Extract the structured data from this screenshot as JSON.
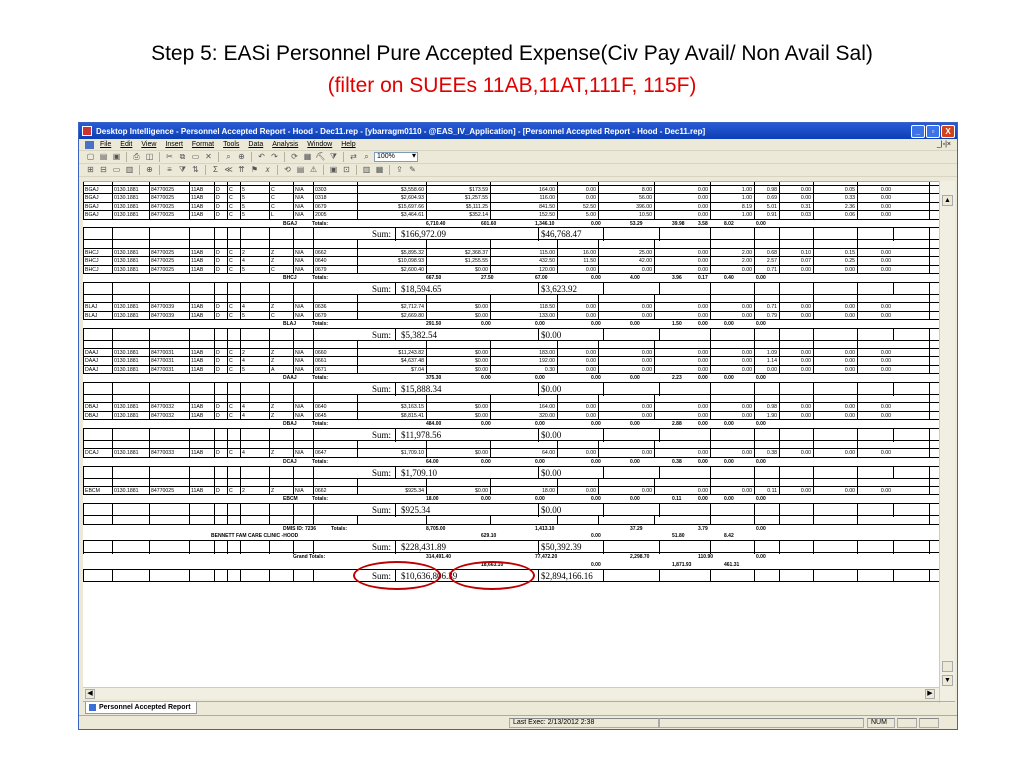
{
  "slide": {
    "title": "Step 5:  EASi Personnel Pure Accepted Expense(Civ Pay Avail/ Non Avail Sal)",
    "subtitle": "(filter on SUEEs 11AB,11AT,111F, 115F)"
  },
  "window": {
    "title": "Desktop Intelligence - Personnel Accepted Report - Hood - Dec11.rep - [ybarragm0110 - @EAS_IV_Application] - [Personnel Accepted Report - Hood - Dec11.rep]",
    "buttons": [
      "_",
      "▫",
      "X"
    ],
    "mdi_buttons": "_|▫|×"
  },
  "menu": [
    "File",
    "Edit",
    "View",
    "Insert",
    "Format",
    "Tools",
    "Data",
    "Analysis",
    "Window",
    "Help"
  ],
  "toolbar": {
    "zoom": "100%"
  },
  "report": {
    "groups": [
      {
        "rows": [
          [
            "BGAJ",
            "0130.1881",
            "84770025",
            "11AB",
            "D",
            "C",
            "5",
            "C",
            "N/A",
            "0303",
            "$3,558.60",
            "$173.59",
            "164.00",
            "0.00",
            "8.00",
            "0.00",
            "1.00",
            "0.98",
            "0.00",
            "0.05",
            "0.00"
          ],
          [
            "BGAJ",
            "0130.1881",
            "84770025",
            "11AB",
            "D",
            "C",
            "5",
            "C",
            "N/A",
            "0318",
            "$2,604.93",
            "$1,257.55",
            "116.00",
            "0.00",
            "56.00",
            "0.00",
            "1.00",
            "0.69",
            "0.00",
            "0.33",
            "0.00"
          ],
          [
            "BGAJ",
            "0130.1881",
            "84770025",
            "11AB",
            "D",
            "C",
            "5",
            "C",
            "N/A",
            "0679",
            "$15,697.66",
            "$5,111.25",
            "841.50",
            "52.50",
            "396.00",
            "0.00",
            "8.19",
            "5.01",
            "0.31",
            "2.36",
            "0.00"
          ],
          [
            "BGAJ",
            "0130.1881",
            "84770025",
            "11AB",
            "D",
            "C",
            "5",
            "L",
            "N/A",
            "2005",
            "$3,464.61",
            "$352.14",
            "152.50",
            "5.00",
            "10.50",
            "0.00",
            "1.00",
            "0.91",
            "0.03",
            "0.06",
            "0.00"
          ]
        ],
        "totals_label": "BGAJ",
        "totals": [
          "6,710.40",
          "601.60",
          "1,346.10",
          "0.00",
          "53.29",
          "39.98",
          "3.58",
          "8.02",
          "0.00"
        ],
        "sum_a": "$166,972.09",
        "sum_b": "$46,768.47"
      },
      {
        "rows": [
          [
            "BHCJ",
            "0130.1881",
            "84770025",
            "11AB",
            "D",
            "C",
            "2",
            "Z",
            "N/A",
            "0662",
            "$5,895.32",
            "$2,368.37",
            "115.00",
            "16.00",
            "25.00",
            "0.00",
            "2.00",
            "0.68",
            "0.10",
            "0.15",
            "0.00"
          ],
          [
            "BHCJ",
            "0130.1881",
            "84770025",
            "11AB",
            "D",
            "C",
            "4",
            "Z",
            "N/A",
            "0640",
            "$10,098.93",
            "$1,255.55",
            "432.50",
            "11.50",
            "42.00",
            "0.00",
            "2.00",
            "2.57",
            "0.07",
            "0.25",
            "0.00"
          ],
          [
            "BHCJ",
            "0130.1881",
            "84770025",
            "11AB",
            "D",
            "C",
            "5",
            "C",
            "N/A",
            "0679",
            "$2,600.40",
            "$0.00",
            "120.00",
            "0.00",
            "0.00",
            "0.00",
            "0.00",
            "0.71",
            "0.00",
            "0.00",
            "0.00"
          ]
        ],
        "totals_label": "BHCJ",
        "totals": [
          "667.50",
          "27.50",
          "67.00",
          "0.00",
          "4.00",
          "3.96",
          "0.17",
          "0.40",
          "0.00"
        ],
        "sum_a": "$18,594.65",
        "sum_b": "$3,623.92"
      },
      {
        "rows": [
          [
            "BLAJ",
            "0130.1881",
            "84770039",
            "11AB",
            "D",
            "C",
            "4",
            "Z",
            "N/A",
            "0636",
            "$2,712.74",
            "$0.00",
            "118.50",
            "0.00",
            "0.00",
            "0.00",
            "0.00",
            "0.71",
            "0.00",
            "0.00",
            "0.00"
          ],
          [
            "BLAJ",
            "0130.1881",
            "84770039",
            "11AB",
            "D",
            "C",
            "5",
            "C",
            "N/A",
            "0679",
            "$2,669.80",
            "$0.00",
            "133.00",
            "0.00",
            "0.00",
            "0.00",
            "0.00",
            "0.79",
            "0.00",
            "0.00",
            "0.00"
          ]
        ],
        "totals_label": "BLAJ",
        "totals": [
          "291.50",
          "0.00",
          "0.00",
          "0.00",
          "0.00",
          "1.50",
          "0.00",
          "0.00",
          "0.00"
        ],
        "sum_a": "$5,382.54",
        "sum_b": "$0.00"
      },
      {
        "rows": [
          [
            "DAAJ",
            "0130.1881",
            "84770031",
            "11AB",
            "D",
            "C",
            "2",
            "Z",
            "N/A",
            "0660",
            "$11,243.82",
            "$0.00",
            "183.00",
            "0.00",
            "0.00",
            "0.00",
            "0.00",
            "1.09",
            "0.00",
            "0.00",
            "0.00"
          ],
          [
            "DAAJ",
            "0130.1881",
            "84770031",
            "11AB",
            "D",
            "C",
            "4",
            "Z",
            "N/A",
            "0661",
            "$4,637.48",
            "$0.00",
            "192.00",
            "0.00",
            "0.00",
            "0.00",
            "0.00",
            "1.14",
            "0.00",
            "0.00",
            "0.00"
          ],
          [
            "DAAJ",
            "0130.1881",
            "84770031",
            "11AB",
            "D",
            "C",
            "5",
            "A",
            "N/A",
            "0671",
            "$7.04",
            "$0.00",
            "0.30",
            "0.00",
            "0.00",
            "0.00",
            "0.00",
            "0.00",
            "0.00",
            "0.00",
            "0.00"
          ]
        ],
        "totals_label": "DAAJ",
        "totals": [
          "375.30",
          "0.00",
          "0.00",
          "0.00",
          "0.00",
          "2.23",
          "0.00",
          "0.00",
          "0.00"
        ],
        "sum_a": "$15,888.34",
        "sum_b": "$0.00"
      },
      {
        "rows": [
          [
            "DBAJ",
            "0130.1881",
            "84770032",
            "11AB",
            "D",
            "C",
            "4",
            "Z",
            "N/A",
            "0640",
            "$3,163.15",
            "$0.00",
            "164.00",
            "0.00",
            "0.00",
            "0.00",
            "0.00",
            "0.98",
            "0.00",
            "0.00",
            "0.00"
          ],
          [
            "DBAJ",
            "0130.1881",
            "84770032",
            "11AB",
            "D",
            "C",
            "4",
            "Z",
            "N/A",
            "0645",
            "$8,815.41",
            "$0.00",
            "320.00",
            "0.00",
            "0.00",
            "0.00",
            "0.00",
            "1.90",
            "0.00",
            "0.00",
            "0.00"
          ]
        ],
        "totals_label": "DBAJ",
        "totals": [
          "484.00",
          "0.00",
          "0.00",
          "0.00",
          "0.00",
          "2.88",
          "0.00",
          "0.00",
          "0.00"
        ],
        "sum_a": "$11,978.56",
        "sum_b": "$0.00"
      },
      {
        "rows": [
          [
            "DCAJ",
            "0130.1881",
            "84770033",
            "11AB",
            "D",
            "C",
            "4",
            "Z",
            "N/A",
            "0647",
            "$1,709.10",
            "$0.00",
            "64.00",
            "0.00",
            "0.00",
            "0.00",
            "0.00",
            "0.38",
            "0.00",
            "0.00",
            "0.00"
          ]
        ],
        "totals_label": "DCAJ",
        "totals": [
          "64.00",
          "0.00",
          "0.00",
          "0.00",
          "0.00",
          "0.38",
          "0.00",
          "0.00",
          "0.00"
        ],
        "sum_a": "$1,709.10",
        "sum_b": "$0.00"
      },
      {
        "rows": [
          [
            "EBCM",
            "0130.1881",
            "84770025",
            "11AB",
            "D",
            "C",
            "2",
            "Z",
            "N/A",
            "0662",
            "$925.34",
            "$0.00",
            "18.00",
            "0.00",
            "0.00",
            "0.00",
            "0.00",
            "0.11",
            "0.00",
            "0.00",
            "0.00"
          ]
        ],
        "totals_label": "EBCM",
        "totals": [
          "18.00",
          "0.00",
          "0.00",
          "0.00",
          "0.00",
          "0.11",
          "0.00",
          "0.00",
          "0.00"
        ],
        "sum_a": "$925.34",
        "sum_b": "$0.00"
      }
    ],
    "totals_word": "Totals:",
    "sum_label": "Sum:",
    "dmis": {
      "label": "DMIS ID: 7236",
      "totals_word": "Totals:",
      "values": [
        "8,705.00",
        "1,413.10",
        "37.29",
        "3.79",
        "0.00"
      ]
    },
    "clinic": {
      "label": "BENNETT FAM CARE CLINIC -HOOD",
      "values": [
        "629.10",
        "0.00",
        "51.80",
        "8.42"
      ],
      "sum_a": "$228,431.89",
      "sum_b": "$50,392.39"
    },
    "grand": {
      "label": "Grand Totals:",
      "values_top": [
        "314,491.40",
        "77,472.20",
        "2,298.70",
        "110.90",
        "0.00"
      ],
      "values_bottom": [
        "18,663.10",
        "0.00",
        "1,871.93",
        "461.31"
      ],
      "sum_a": "$10,636,806.39",
      "sum_b": "$2,894,166.16"
    }
  },
  "tab": "Personnel Accepted Report",
  "status": {
    "last_exec": "Last Exec: 2/13/2012 2:38",
    "num": "NUM"
  }
}
